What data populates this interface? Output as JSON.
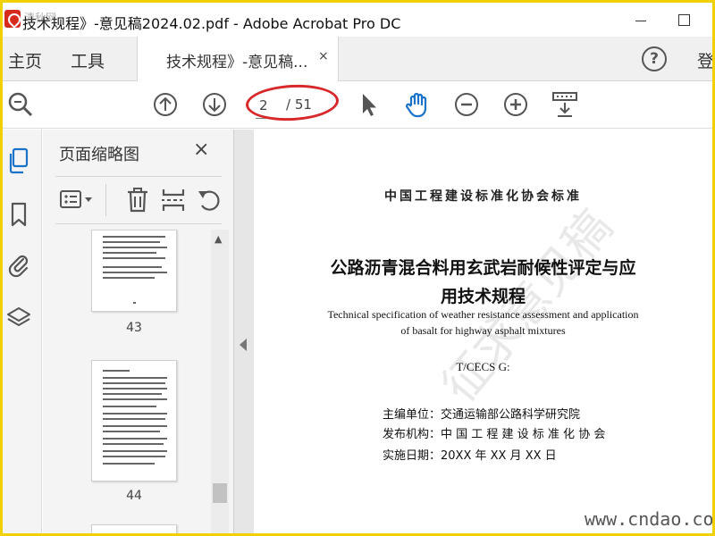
{
  "window": {
    "title": "技术规程》-意见稿2024.02.pdf - Adobe Acrobat Pro DC",
    "corner_watermark": "清秋网"
  },
  "tabs": {
    "home": "主页",
    "tools": "工具",
    "document": "技术规程》-意见稿...",
    "close": "×",
    "help": "?",
    "login": "登"
  },
  "toolbar": {
    "current_page": "2",
    "total_pages": "/ 51"
  },
  "thumbnails_panel": {
    "title": "页面缩略图",
    "close": "×",
    "pages": [
      {
        "label": "43"
      },
      {
        "label": "44"
      }
    ]
  },
  "document": {
    "org_header": "中国工程建设标准化协会标准",
    "title_line_1": "公路沥青混合料用玄武岩耐候性评定与应",
    "title_line_2": "用技术规程",
    "english_line_1": "Technical specification of weather resistance assessment and application",
    "english_line_2": "of basalt for highway asphalt mixtures",
    "code": "T/CECS G:",
    "editor": "主编单位：交通运输部公路科学研究院",
    "publisher": "发布机构：中 国 工 程 建 设 标 准 化 协 会",
    "date": "实施日期：20XX 年 XX 月 XX 日",
    "watermark": "征求意见稿",
    "site_watermark": "www.cndao.com"
  },
  "colors": {
    "border": "#f2d000",
    "highlight": "#d8282a",
    "hand_tool": "#1a73c8",
    "sidebar_active": "#1a73c8"
  }
}
